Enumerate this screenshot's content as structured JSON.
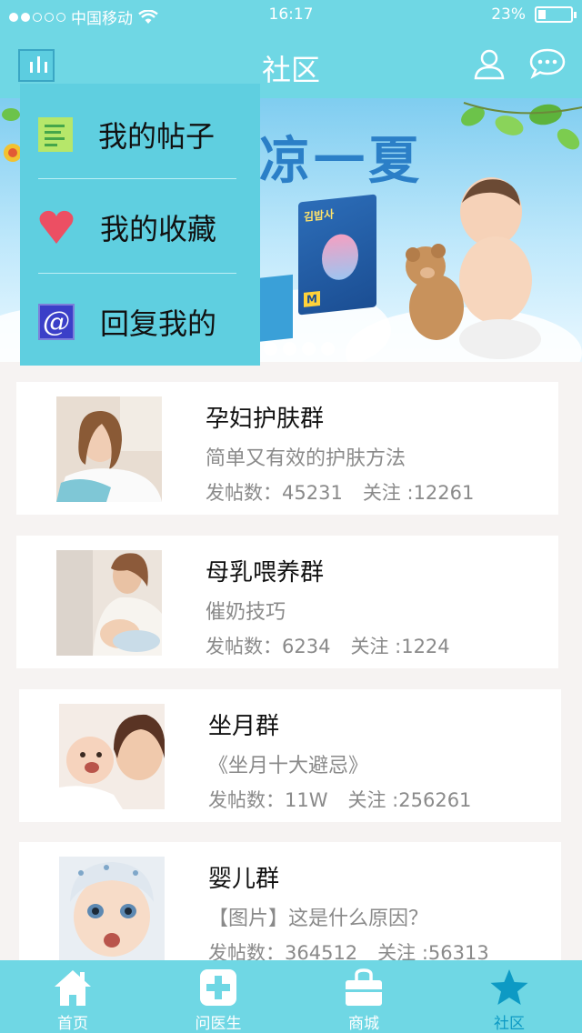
{
  "status_bar": {
    "carrier": "中国移动",
    "time": "16:17",
    "battery": "23%",
    "battery_level": 0.23
  },
  "nav": {
    "title": "社区"
  },
  "banner": {
    "headline": "凉一夏",
    "pack_label": "김밥사",
    "pack_size": "M"
  },
  "dropdown": {
    "items": [
      {
        "label": "我的帖子",
        "icon": "document-icon"
      },
      {
        "label": "我的收藏",
        "icon": "heart-icon"
      },
      {
        "label": "回复我的",
        "icon": "at-icon"
      }
    ]
  },
  "groups": [
    {
      "name": "孕妇护肤群",
      "desc": "简单又有效的护肤方法",
      "posts_label": "发帖数：45231",
      "follow_label": "关注 :12261"
    },
    {
      "name": "母乳喂养群",
      "desc": "催奶技巧",
      "posts_label": "发帖数：6234",
      "follow_label": "关注 :1224"
    },
    {
      "name": "坐月群",
      "desc": "《坐月十大避忌》",
      "posts_label": "发帖数：11W",
      "follow_label": "关注 :256261"
    },
    {
      "name": "婴儿群",
      "desc": "【图片】这是什么原因？",
      "posts_label": "发帖数：364512",
      "follow_label": "关注 :56313"
    }
  ],
  "tabs": [
    {
      "label": "首页",
      "icon": "home-icon"
    },
    {
      "label": "问医生",
      "icon": "medical-cross-icon"
    },
    {
      "label": "商城",
      "icon": "shopping-bag-icon"
    },
    {
      "label": "社区",
      "icon": "star-icon"
    }
  ],
  "colors": {
    "accent": "#6fd7e4",
    "active_tab": "#0d9ac4",
    "dropdown_bg": "#5fcfe0"
  }
}
